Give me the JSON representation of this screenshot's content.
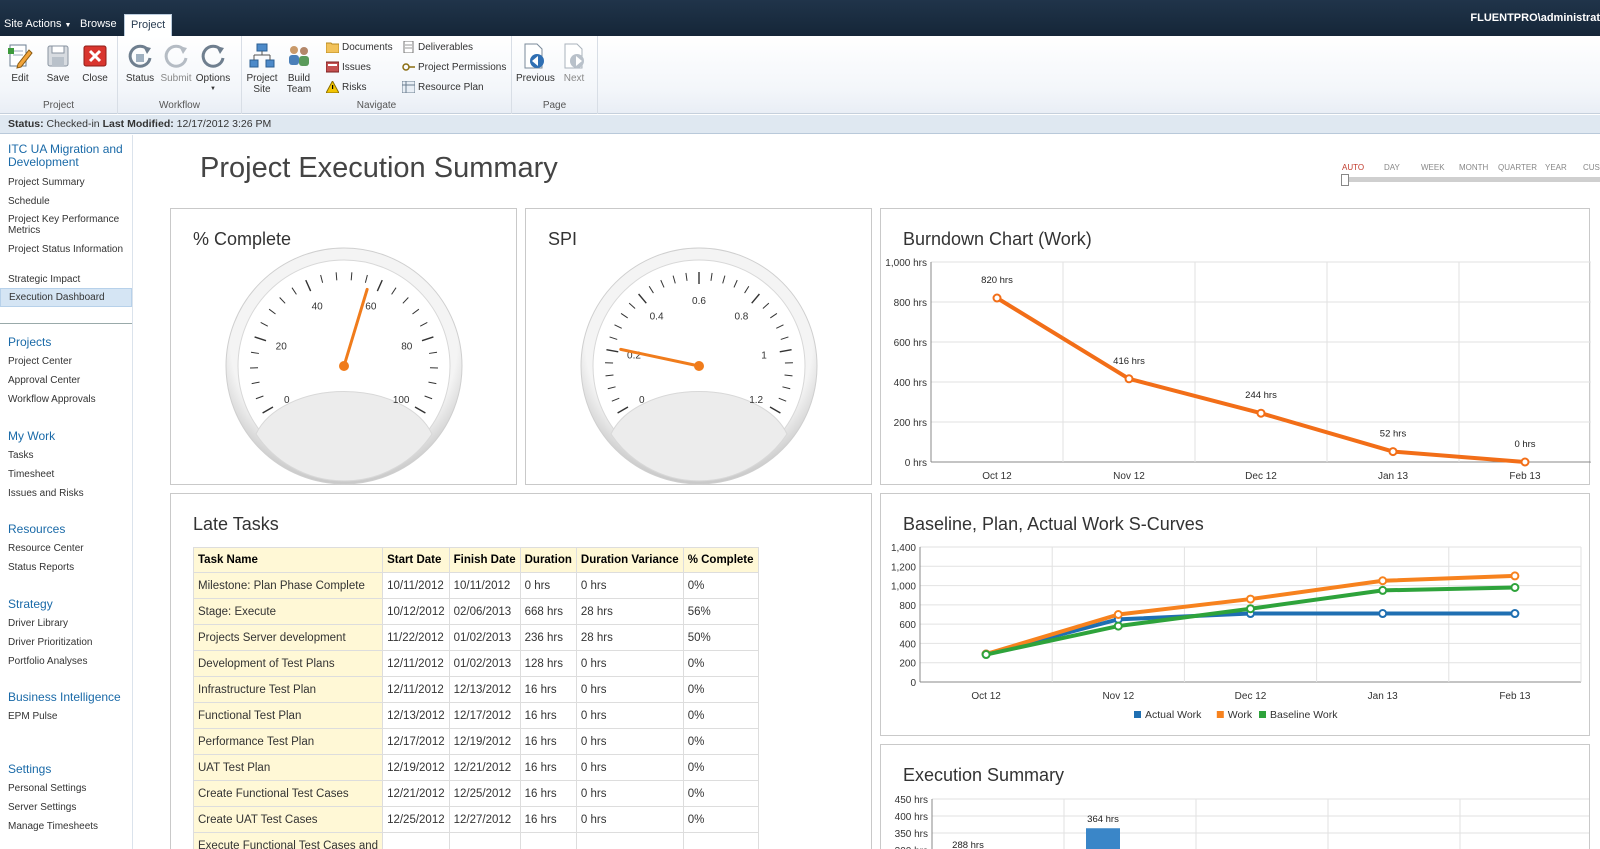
{
  "topbar": {
    "site_actions": "Site Actions",
    "tabs": [
      "Browse",
      "Project"
    ],
    "user": "FLUENTPRO\\administrat"
  },
  "ribbon": {
    "groups": [
      {
        "label": "Project",
        "buttons": [
          "Edit",
          "Save",
          "Close"
        ]
      },
      {
        "label": "Workflow",
        "buttons": [
          "Status",
          "Submit",
          "Options"
        ]
      },
      {
        "label": "Navigate",
        "buttons": [
          "Project Site",
          "Build Team"
        ],
        "small": [
          "Documents",
          "Issues",
          "Risks",
          "Deliverables",
          "Project Permissions",
          "Resource Plan"
        ]
      },
      {
        "label": "Page",
        "buttons": [
          "Previous",
          "Next"
        ]
      }
    ],
    "colors": {
      "close": "#d9352e",
      "orange": "#f07c1c",
      "blue": "#2f6fb3"
    }
  },
  "status": {
    "status_label": "Status:",
    "status_value": "Checked-in",
    "modified_label": "Last Modified:",
    "modified_value": "12/17/2012 3:26 PM"
  },
  "leftnav": {
    "project_title": "ITC UA Migration and Development",
    "project_items": [
      "Project Summary",
      "Schedule",
      "Project Key Performance Metrics",
      "Project Status Information",
      "Strategic Impact",
      "Execution Dashboard"
    ],
    "sections": [
      {
        "head": "Projects",
        "items": [
          "Project Center",
          "Approval Center",
          "Workflow Approvals"
        ]
      },
      {
        "head": "My Work",
        "items": [
          "Tasks",
          "Timesheet",
          "Issues and Risks"
        ]
      },
      {
        "head": "Resources",
        "items": [
          "Resource Center",
          "Status Reports"
        ]
      },
      {
        "head": "Strategy",
        "items": [
          "Driver Library",
          "Driver Prioritization",
          "Portfolio Analyses"
        ]
      },
      {
        "head": "Business Intelligence",
        "items": [
          "EPM Pulse"
        ]
      },
      {
        "head": "Settings",
        "items": [
          "Personal Settings",
          "Server Settings",
          "Manage Timesheets"
        ]
      }
    ]
  },
  "main": {
    "title": "Project Execution Summary",
    "timeline": [
      "AUTO",
      "DAY",
      "WEEK",
      "MONTH",
      "QUARTER",
      "YEAR",
      "CUS"
    ]
  },
  "chart_data": [
    {
      "type": "gauge",
      "title": "% Complete",
      "min": 0,
      "max": 100,
      "tick_labels": [
        "0",
        "20",
        "40",
        "60",
        "80",
        "100"
      ],
      "value": 57
    },
    {
      "type": "gauge",
      "title": "SPI",
      "min": 0,
      "max": 1.2,
      "tick_labels": [
        "0",
        "0.2",
        "0.4",
        "0.6",
        "0.8",
        "1",
        "1.2"
      ],
      "value": 0.21
    },
    {
      "type": "line",
      "title": "Burndown Chart (Work)",
      "categories": [
        "Oct 12",
        "Nov 12",
        "Dec 12",
        "Jan 13",
        "Feb 13"
      ],
      "y_tick_labels": [
        "0 hrs",
        "200 hrs",
        "400 hrs",
        "600 hrs",
        "800 hrs",
        "1,000 hrs"
      ],
      "ylim": [
        0,
        1000
      ],
      "series": [
        {
          "values": [
            820,
            416,
            244,
            52,
            0
          ],
          "color": "#f26e18"
        }
      ],
      "data_labels": [
        "820 hrs",
        "416 hrs",
        "244 hrs",
        "52 hrs",
        "0 hrs"
      ],
      "grid": true
    },
    {
      "type": "line",
      "title": "Baseline, Plan, Actual Work S-Curves",
      "categories": [
        "Oct 12",
        "Nov 12",
        "Dec 12",
        "Jan 13",
        "Feb 13"
      ],
      "y_tick_labels": [
        "0",
        "200",
        "400",
        "600",
        "800",
        "1,000",
        "1,200",
        "1,400"
      ],
      "ylim": [
        0,
        1400
      ],
      "series": [
        {
          "name": "Actual Work",
          "values": [
            290,
            650,
            710,
            710,
            710
          ],
          "color": "#1f6fb2"
        },
        {
          "name": "Work",
          "values": [
            290,
            700,
            860,
            1050,
            1100
          ],
          "color": "#f7821e"
        },
        {
          "name": "Baseline Work",
          "values": [
            285,
            580,
            760,
            950,
            980
          ],
          "color": "#2ea33b"
        }
      ],
      "legend": "bottom",
      "grid": true
    },
    {
      "type": "bar",
      "title": "Execution Summary",
      "y_tick_labels": [
        "450 hrs",
        "400 hrs",
        "350 hrs",
        "300 hrs"
      ],
      "ylim": [
        300,
        450
      ],
      "data_labels": [
        "288 hrs",
        "364 hrs"
      ],
      "values": [
        288,
        364
      ],
      "color": "#3a86c8"
    }
  ],
  "late_tasks": {
    "title": "Late Tasks",
    "columns": [
      "Task Name",
      "Start Date",
      "Finish Date",
      "Duration",
      "Duration Variance",
      "% Complete"
    ],
    "rows": [
      [
        "Milestone: Plan Phase Complete",
        "10/11/2012",
        "10/11/2012",
        "0 hrs",
        "0 hrs",
        "0%"
      ],
      [
        "Stage: Execute",
        "10/12/2012",
        "02/06/2013",
        "668 hrs",
        "28 hrs",
        "56%"
      ],
      [
        "Projects Server development",
        "11/22/2012",
        "01/02/2013",
        "236 hrs",
        "28 hrs",
        "50%"
      ],
      [
        "Development of Test Plans",
        "12/11/2012",
        "01/02/2013",
        "128 hrs",
        "0 hrs",
        "0%"
      ],
      [
        "Infrastructure Test Plan",
        "12/11/2012",
        "12/13/2012",
        "16 hrs",
        "0 hrs",
        "0%"
      ],
      [
        "Functional Test Plan",
        "12/13/2012",
        "12/17/2012",
        "16 hrs",
        "0 hrs",
        "0%"
      ],
      [
        "Performance Test Plan",
        "12/17/2012",
        "12/19/2012",
        "16 hrs",
        "0 hrs",
        "0%"
      ],
      [
        "UAT Test Plan",
        "12/19/2012",
        "12/21/2012",
        "16 hrs",
        "0 hrs",
        "0%"
      ],
      [
        "Create Functional Test Cases",
        "12/21/2012",
        "12/25/2012",
        "16 hrs",
        "0 hrs",
        "0%"
      ],
      [
        "Create UAT Test Cases",
        "12/25/2012",
        "12/27/2012",
        "16 hrs",
        "0 hrs",
        "0%"
      ],
      [
        "Execute Functional Test Cases and",
        "",
        "",
        "",
        "",
        ""
      ]
    ]
  }
}
